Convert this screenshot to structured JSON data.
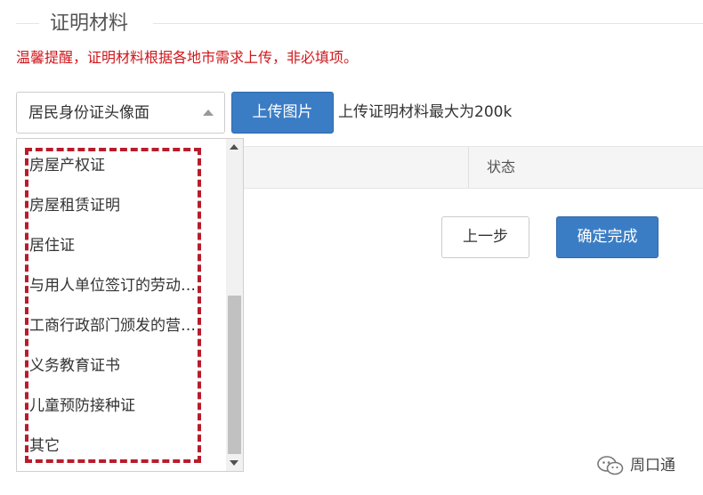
{
  "section": {
    "title": "证明材料",
    "tip": "温馨提醒，证明材料根据各地市需求上传，非必填项。"
  },
  "upload": {
    "selected": "居民身份证头像面",
    "button_label": "上传图片",
    "note": "上传证明材料最大为200k"
  },
  "dropdown": {
    "options": [
      "房屋产权证",
      "房屋租赁证明",
      "居住证",
      "与用人单位签订的劳动…",
      "工商行政部门颁发的营…",
      "义务教育证书",
      "儿童预防接种证",
      "其它"
    ]
  },
  "table": {
    "status_header": "状态"
  },
  "actions": {
    "prev_label": "上一步",
    "confirm_label": "确定完成"
  },
  "watermark": {
    "text": "周口通"
  },
  "colors": {
    "primary_button": "#3b7dc4",
    "tip_text": "#d0161b",
    "highlight_dash": "#b81c2b"
  }
}
